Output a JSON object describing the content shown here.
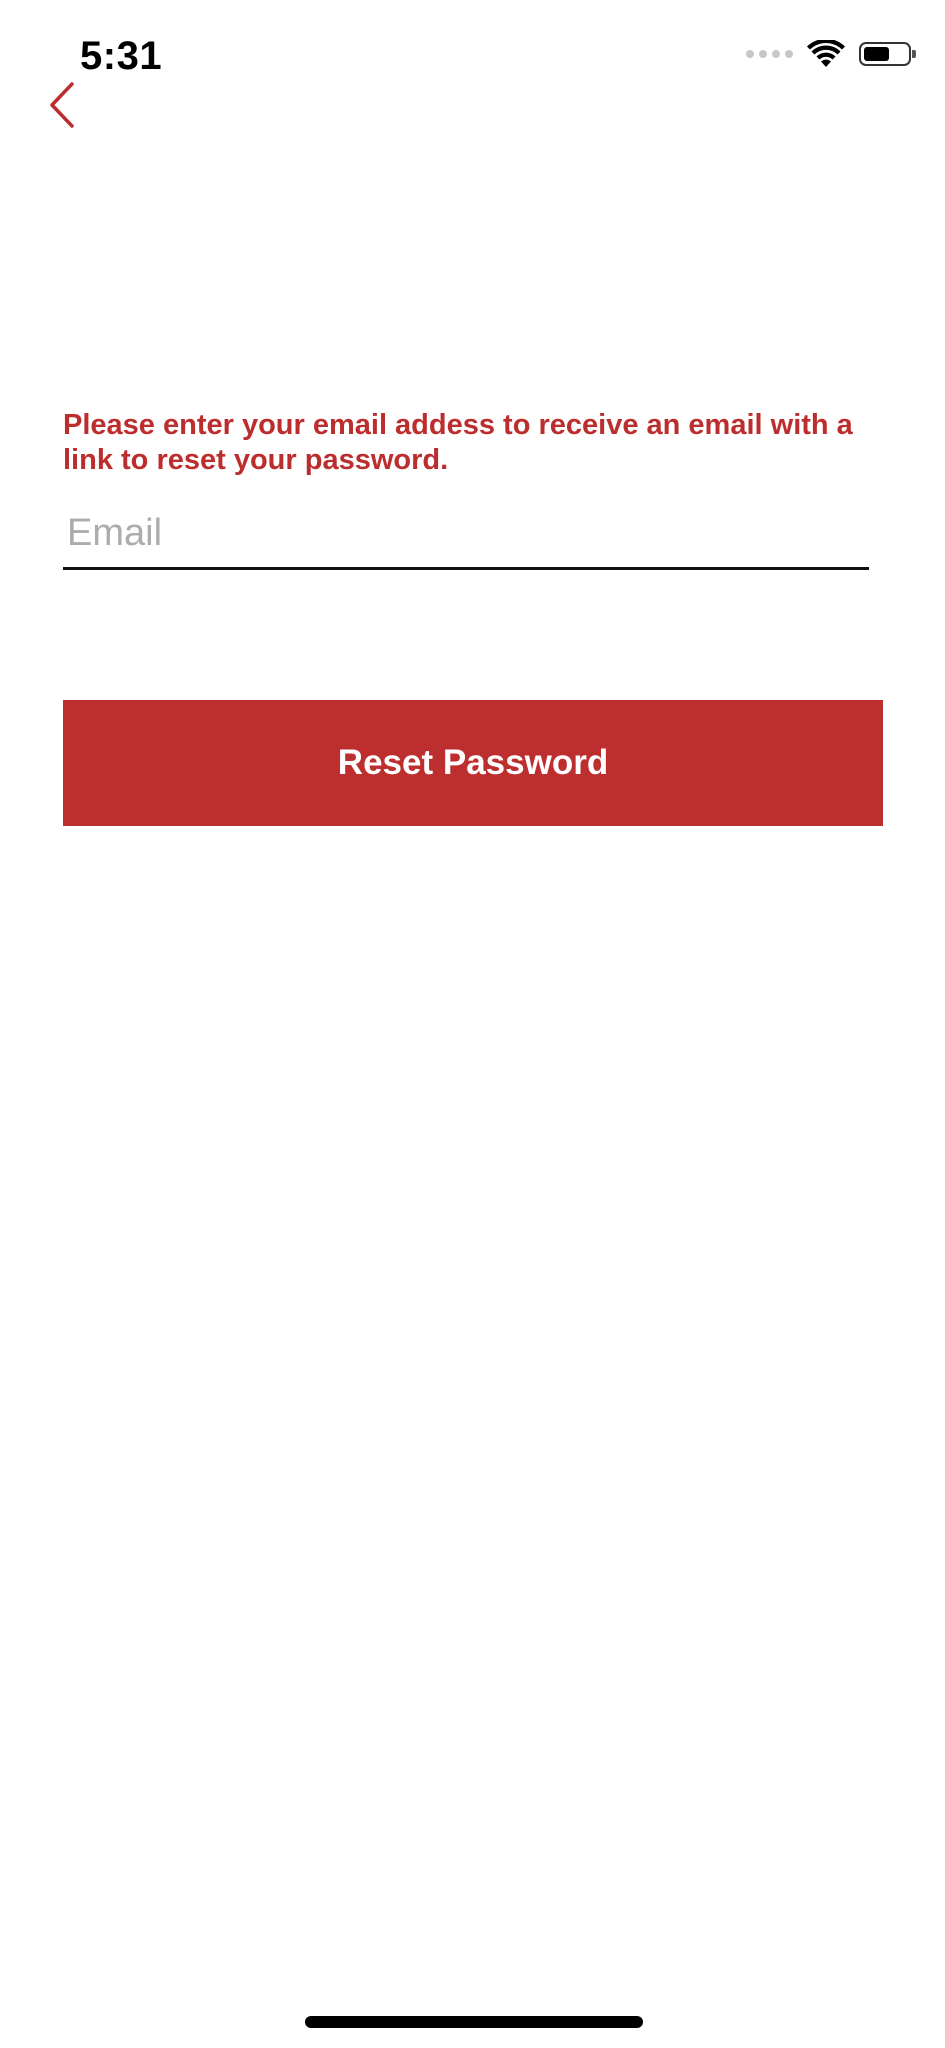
{
  "status_bar": {
    "time": "5:31",
    "icons": [
      "signal-icon",
      "wifi-icon",
      "battery-icon"
    ]
  },
  "nav": {
    "back_icon": "chevron-left-icon"
  },
  "form": {
    "instruction": "Please enter your email addess to receive an email with a link to reset your password.",
    "email_placeholder": "Email",
    "email_value": "",
    "submit_label": "Reset Password"
  },
  "colors": {
    "accent": "#bc2e2e",
    "button_bg": "#bd2f2e",
    "placeholder": "#acacac",
    "underline": "#111111"
  }
}
